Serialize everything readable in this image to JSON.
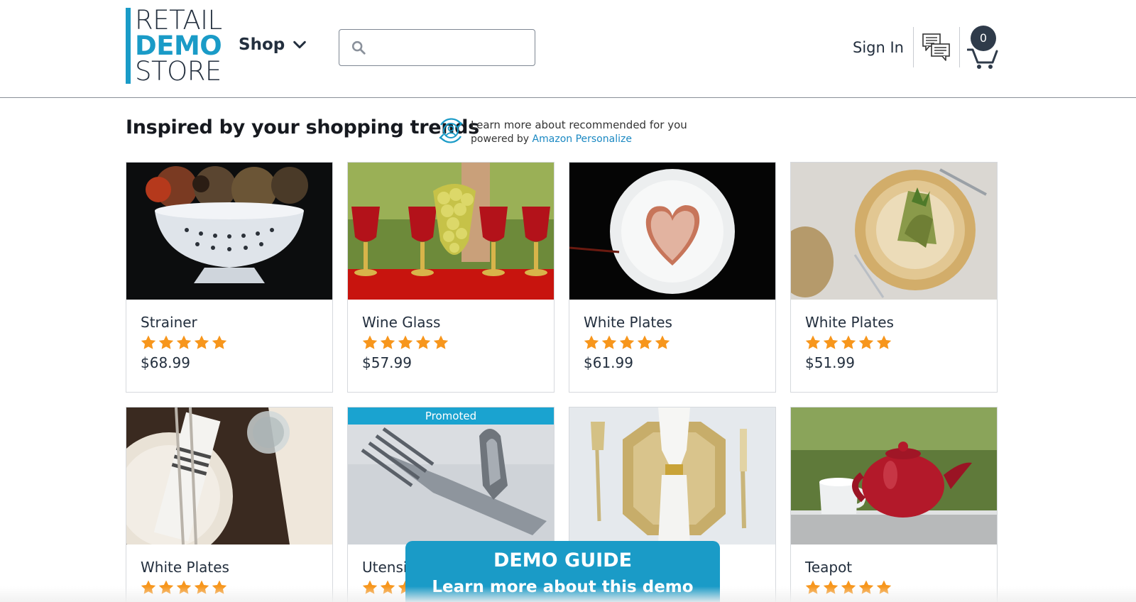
{
  "header": {
    "logo": {
      "line1": "RETAIL",
      "line2": "DEMO",
      "line3": "STORE"
    },
    "shop_label": "Shop",
    "search": {
      "value": "",
      "placeholder": ""
    },
    "signin_label": "Sign In",
    "cart_count": "0"
  },
  "section": {
    "title": "Inspired by your shopping trends",
    "learn_more": "Learn more about recommended for you",
    "powered_by": "powered by",
    "powered_link": "Amazon Personalize"
  },
  "products": [
    {
      "name": "Strainer",
      "price": "$68.99",
      "rating": 5,
      "promoted": false
    },
    {
      "name": "Wine Glass",
      "price": "$57.99",
      "rating": 5,
      "promoted": false
    },
    {
      "name": "White Plates",
      "price": "$61.99",
      "rating": 5,
      "promoted": false
    },
    {
      "name": "White Plates",
      "price": "$51.99",
      "rating": 5,
      "promoted": false
    },
    {
      "name": "White Plates",
      "price": "",
      "rating": 5,
      "promoted": false
    },
    {
      "name": "Utensil",
      "price": "",
      "rating": 5,
      "promoted": true,
      "promoted_label": "Promoted"
    },
    {
      "name": "",
      "price": "",
      "rating": 5,
      "promoted": false
    },
    {
      "name": "Teapot",
      "price": "",
      "rating": 5,
      "promoted": false
    }
  ],
  "demo_guide": {
    "title": "DEMO GUIDE",
    "subtitle": "Learn more about this demo"
  },
  "colors": {
    "brand": "#1a9bc7",
    "star": "#f7961c",
    "text": "#232f3e"
  }
}
